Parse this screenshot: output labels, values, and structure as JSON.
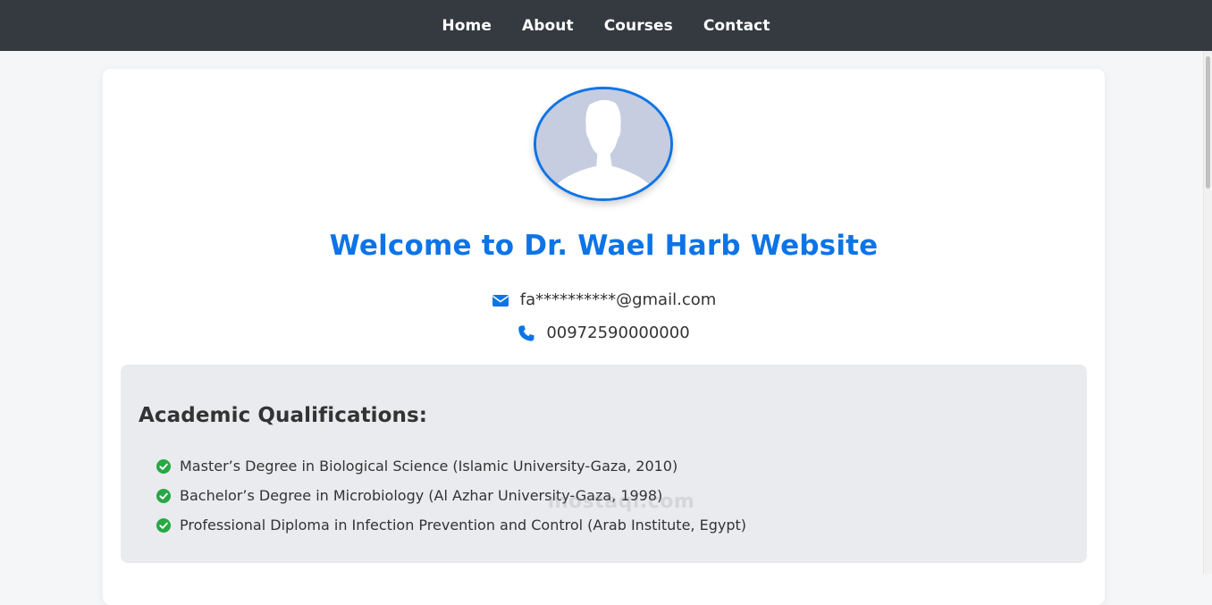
{
  "nav": {
    "items": [
      {
        "label": "Home"
      },
      {
        "label": "About"
      },
      {
        "label": "Courses"
      },
      {
        "label": "Contact"
      }
    ]
  },
  "profile": {
    "title": "Welcome to Dr. Wael Harb Website",
    "email": "fa**********@gmail.com",
    "phone": "00972590000000",
    "email_icon": "envelope-icon",
    "phone_icon": "phone-icon"
  },
  "qualifications": {
    "heading": "Academic Qualifications:",
    "items": [
      "Master’s Degree in Biological Science (Islamic University-Gaza, 2010)",
      "Bachelor’s Degree in Microbiology (Al Azhar University-Gaza, 1998)",
      "Professional Diploma in Infection Prevention and Control (Arab Institute, Egypt)"
    ]
  },
  "watermark": "mostaql.com",
  "colors": {
    "navbar": "#343a40",
    "accent": "#0d74e7",
    "check": "#28a745",
    "section_bg": "#e9ebee"
  }
}
